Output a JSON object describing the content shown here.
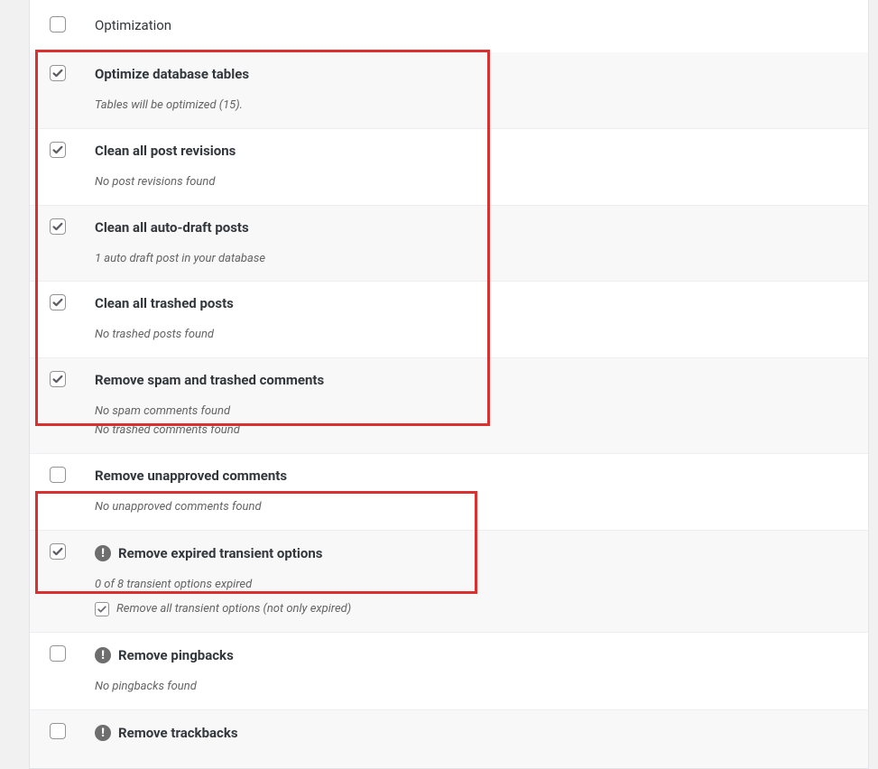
{
  "header": {
    "title": "Optimization"
  },
  "items": [
    {
      "checked": true,
      "alt": true,
      "warn": false,
      "title": "Optimize database tables",
      "desc": [
        "Tables will be optimized (15)."
      ]
    },
    {
      "checked": true,
      "alt": false,
      "warn": false,
      "title": "Clean all post revisions",
      "desc": [
        "No post revisions found"
      ]
    },
    {
      "checked": true,
      "alt": true,
      "warn": false,
      "title": "Clean all auto-draft posts",
      "desc": [
        "1 auto draft post in your database"
      ]
    },
    {
      "checked": true,
      "alt": false,
      "warn": false,
      "title": "Clean all trashed posts",
      "desc": [
        "No trashed posts found"
      ]
    },
    {
      "checked": true,
      "alt": true,
      "warn": false,
      "title": "Remove spam and trashed comments",
      "desc": [
        "No spam comments found",
        "No trashed comments found"
      ]
    },
    {
      "checked": false,
      "alt": false,
      "warn": false,
      "title": "Remove unapproved comments",
      "desc": [
        "No unapproved comments found"
      ]
    },
    {
      "checked": true,
      "alt": true,
      "warn": true,
      "title": "Remove expired transient options",
      "desc": [
        "0 of 8 transient options expired"
      ],
      "sub": {
        "checked": true,
        "label": "Remove all transient options (not only expired)"
      }
    },
    {
      "checked": false,
      "alt": false,
      "warn": true,
      "title": "Remove pingbacks",
      "desc": [
        "No pingbacks found"
      ]
    },
    {
      "checked": false,
      "alt": true,
      "warn": true,
      "title": "Remove trackbacks",
      "desc": []
    }
  ]
}
